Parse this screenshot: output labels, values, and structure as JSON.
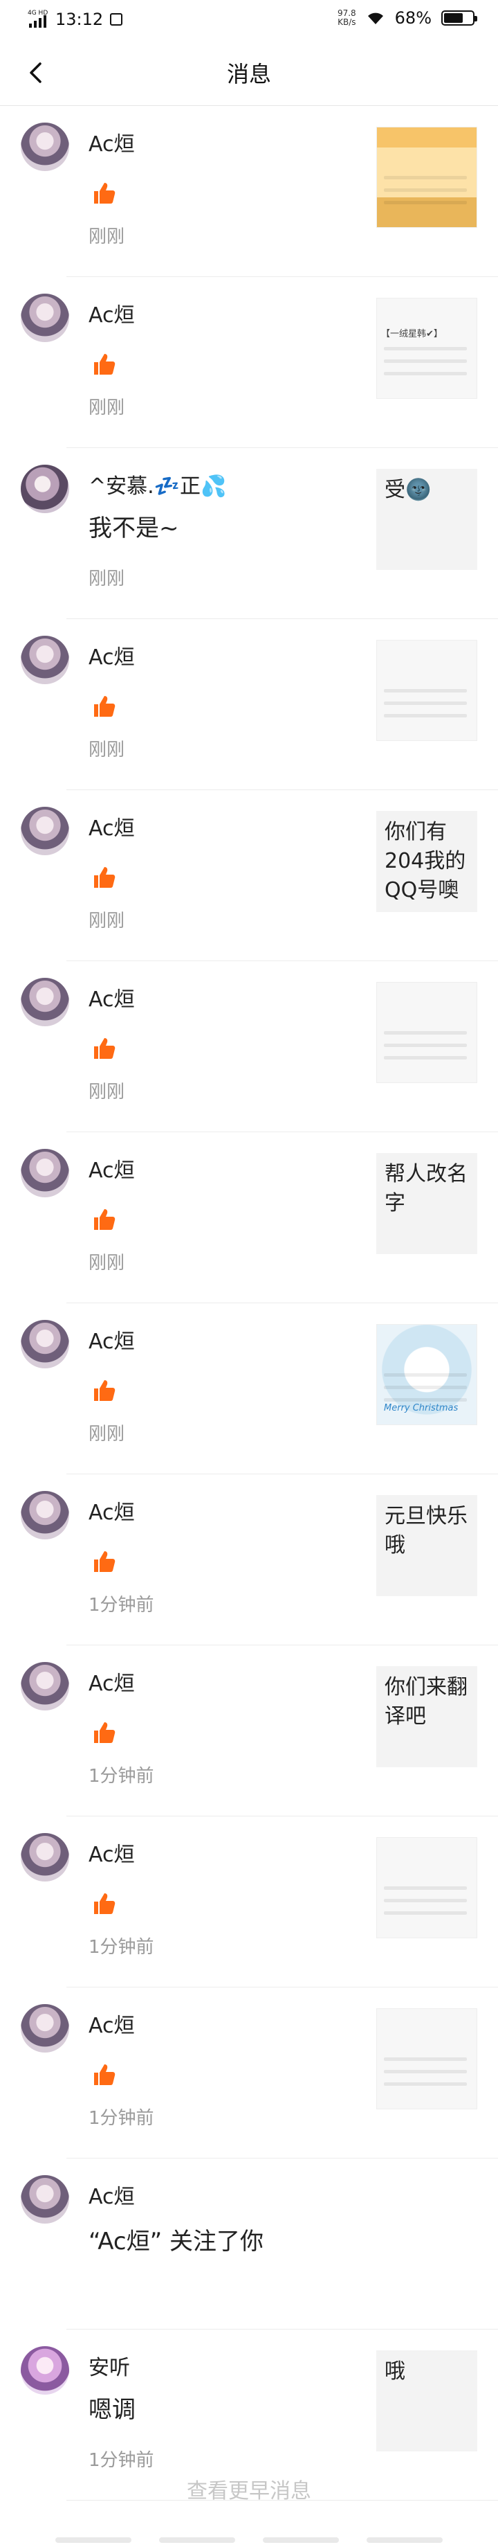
{
  "status_bar": {
    "network": "4G HD",
    "time": "13:12",
    "speed_value": "97.8",
    "speed_unit": "KB/s",
    "battery": "68%",
    "battery_level": 0.68
  },
  "nav": {
    "title": "消息",
    "back_icon": "chevron-left-icon"
  },
  "accent_color": "#ff6a13",
  "messages": [
    {
      "name": "Ac烜",
      "type": "like",
      "time": "刚刚",
      "thumb": {
        "kind": "image",
        "desc": "orange screenshot",
        "text": ""
      }
    },
    {
      "name": "Ac烜",
      "type": "like",
      "time": "刚刚",
      "thumb": {
        "kind": "image",
        "text": "【一绒星韩✔】"
      }
    },
    {
      "name": "^安慕.💤正💦",
      "type": "comment",
      "text": "我不是~",
      "time": "刚刚",
      "thumb": {
        "kind": "text",
        "text": "受🌚"
      }
    },
    {
      "name": "Ac烜",
      "type": "like",
      "time": "刚刚",
      "thumb": {
        "kind": "image",
        "text": ""
      }
    },
    {
      "name": "Ac烜",
      "type": "like",
      "time": "刚刚",
      "thumb": {
        "kind": "text",
        "text": "你们有204我的QQ号噢"
      }
    },
    {
      "name": "Ac烜",
      "type": "like",
      "time": "刚刚",
      "thumb": {
        "kind": "image",
        "text": ""
      }
    },
    {
      "name": "Ac烜",
      "type": "like",
      "time": "刚刚",
      "thumb": {
        "kind": "text",
        "text": "帮人改名字"
      }
    },
    {
      "name": "Ac烜",
      "type": "like",
      "time": "刚刚",
      "thumb": {
        "kind": "image",
        "text": "Merry Christmas"
      }
    },
    {
      "name": "Ac烜",
      "type": "like",
      "time": "1分钟前",
      "thumb": {
        "kind": "text",
        "text": "元旦快乐哦"
      }
    },
    {
      "name": "Ac烜",
      "type": "like",
      "time": "1分钟前",
      "thumb": {
        "kind": "text",
        "text": "你们来翻译吧"
      }
    },
    {
      "name": "Ac烜",
      "type": "like",
      "time": "1分钟前",
      "thumb": {
        "kind": "image",
        "text": ""
      }
    },
    {
      "name": "Ac烜",
      "type": "like",
      "time": "1分钟前",
      "thumb": {
        "kind": "image",
        "text": ""
      }
    },
    {
      "name": "Ac烜",
      "type": "follow",
      "text": "“Ac烜” 关注了你",
      "time": "",
      "thumb": null
    },
    {
      "name": "安听",
      "type": "comment",
      "text": "嗯调",
      "time": "1分钟前",
      "thumb": {
        "kind": "text",
        "text": "哦"
      }
    }
  ],
  "load_more": "查看更早消息"
}
